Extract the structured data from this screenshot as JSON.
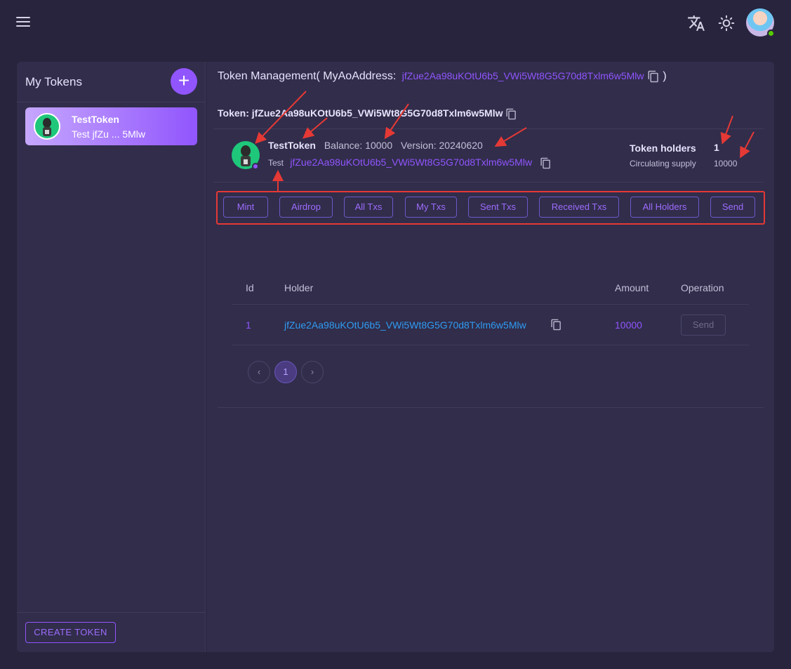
{
  "header": {
    "menu_icon": "menu-icon",
    "translate_icon": "translate-icon",
    "theme_icon": "sun-icon",
    "avatar_icon": "user-avatar"
  },
  "sidebar": {
    "title": "My Tokens",
    "add_label": "+",
    "items": [
      {
        "name": "TestToken",
        "subtitle": "Test jfZu ... 5Mlw"
      }
    ],
    "create_label": "CREATE TOKEN"
  },
  "main": {
    "title_prefix": "Token Management( MyAoAddress:",
    "my_address": "jfZue2Aa98uKOtU6b5_VWi5Wt8G5G70d8Txlm6w5Mlw",
    "title_suffix": ")",
    "token_line": "Token: jfZue2Aa98uKOtU6b5_VWi5Wt8G5G70d8Txlm6w5Mlw",
    "info": {
      "name": "TestToken",
      "balance": "Balance: 10000",
      "version": "Version: 20240620",
      "ticker": "Test",
      "address": "jfZue2Aa98uKOtU6b5_VWi5Wt8G5G70d8Txlm6w5Mlw",
      "holders_label": "Token holders",
      "holders_value": "1",
      "supply_label": "Circulating supply",
      "supply_value": "10000"
    },
    "actions": [
      "Mint",
      "Airdrop",
      "All Txs",
      "My Txs",
      "Sent Txs",
      "Received Txs",
      "All Holders",
      "Send"
    ],
    "table": {
      "headers": [
        "Id",
        "Holder",
        "Amount",
        "Operation"
      ],
      "rows": [
        {
          "id": "1",
          "holder": "jfZue2Aa98uKOtU6b5_VWi5Wt8G5G70d8Txlm6w5Mlw",
          "amount": "10000",
          "operation": "Send"
        }
      ]
    },
    "pagination": {
      "prev": "‹",
      "current": "1",
      "next": "›"
    }
  },
  "colors": {
    "background": "#28243d",
    "panel": "#312d4b",
    "primary": "#9155fd",
    "annotation": "#e53935"
  }
}
